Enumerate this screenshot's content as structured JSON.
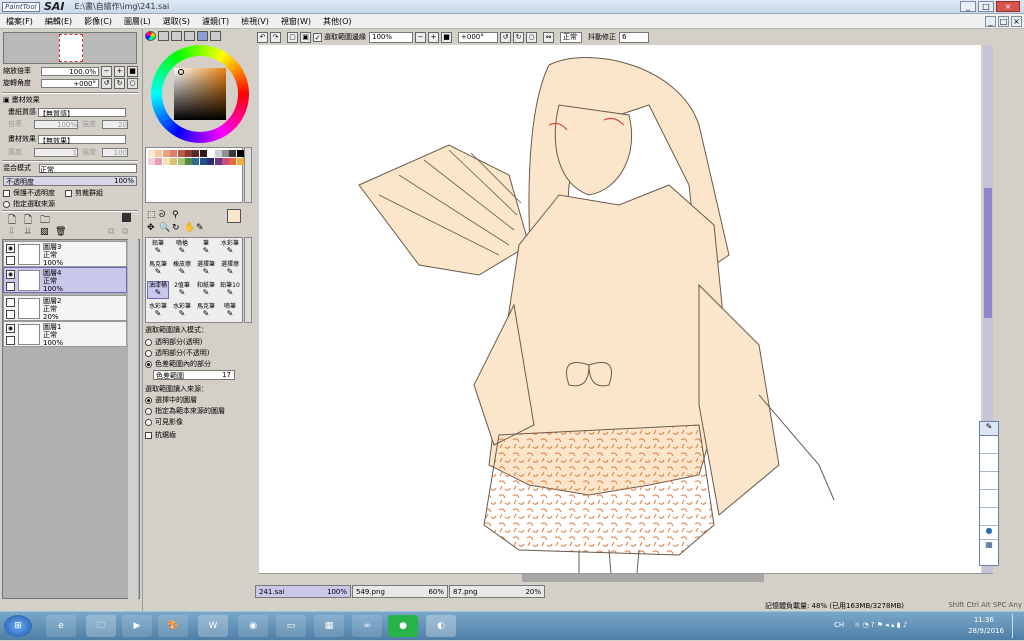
{
  "app": {
    "name": "SAI",
    "logo_text": "PaintTool",
    "doc_title": "E:\\書\\自繪作\\img\\241.sai",
    "window_buttons": [
      "_",
      "□",
      "×"
    ]
  },
  "menu": [
    "檔案(F)",
    "編輯(E)",
    "影像(C)",
    "圖層(L)",
    "選取(S)",
    "濾鏡(T)",
    "檢視(V)",
    "視窗(W)",
    "其他(O)"
  ],
  "nav": {
    "zoom_label": "縮放倍率",
    "zoom_value": "100.0%",
    "rotate_label": "旋轉角度",
    "rotate_value": "+000°"
  },
  "texture": {
    "section_label": "畫材效果",
    "paper_label": "畫紙質感",
    "paper_value": "【無質感】",
    "scale_label": "倍率",
    "scale_value": "100%",
    "strength_label": "強度",
    "strength_value": "20",
    "effect_label": "畫材效果",
    "effect_value": "【無效果】",
    "width_label": "寬度",
    "width_value": "1",
    "strength2_label": "強度",
    "strength2_value": "100"
  },
  "blend": {
    "mode_label": "混合模式",
    "mode_value": "正常",
    "opacity_label": "不透明度",
    "opacity_value": "100%",
    "preserve_opacity": "保護不透明度",
    "clip_group": "剪裁群組",
    "selection_source": "指定選取來源"
  },
  "layers": [
    {
      "name": "圖層3",
      "mode": "正常",
      "opacity": "100%",
      "visible": true,
      "selected": false
    },
    {
      "name": "圖層4",
      "mode": "正常",
      "opacity": "100%",
      "visible": true,
      "selected": true
    },
    {
      "name": "圖層2",
      "mode": "正常",
      "opacity": "20%",
      "visible": false,
      "selected": false
    },
    {
      "name": "圖層1",
      "mode": "正常",
      "opacity": "100%",
      "visible": true,
      "selected": false
    }
  ],
  "tools": [
    "鉛筆",
    "噴槍",
    "筆",
    "水彩筆",
    "馬克筆",
    "橡皮擦",
    "選擇筆",
    "選擇擦",
    "油漆桶",
    "2值筆",
    "和紙筆",
    "鉛筆10",
    "水彩筆",
    "水彩筆",
    "馬克筆",
    "噴筆"
  ],
  "fill_options": {
    "heading": "選取範圍讀入模式：",
    "opt1": "透明部分(透明)",
    "opt2": "透明部分(不透明)",
    "opt3": "色差範圍內的部分",
    "range_label": "色差範圍",
    "range_value": "17",
    "source_heading": "選取範圍讀入來源：",
    "src1": "選擇中的圖層",
    "src2": "指定為範本來源的圖層",
    "src3": "可見影像",
    "antialias": "抗鋸齒"
  },
  "canvas_toolbar": {
    "select_edge": "選取範圍邊緣",
    "zoom": "100%",
    "angle": "+000°",
    "mode": "正常",
    "stabilizer_label": "抖動修正",
    "stabilizer": "6"
  },
  "tabs": [
    {
      "name": "241.sai",
      "zoom": "100%",
      "selected": true
    },
    {
      "name": "549.png",
      "zoom": "60%",
      "selected": false
    },
    {
      "name": "87.png",
      "zoom": "20%",
      "selected": false
    }
  ],
  "status": {
    "memory": "記憶體負載量: 48% (已用163MB/3278MB)",
    "keys": "Shift Ctrl Alt SPC Any"
  },
  "taskbar": {
    "lang": "CH",
    "time": "11:36",
    "date": "28/9/2016"
  },
  "colors": {
    "accent": "#6e6ab9",
    "selected_bg": "#c9c7ea",
    "skin": "#fbe6cc",
    "orange_pattern": "#e07a3c"
  }
}
